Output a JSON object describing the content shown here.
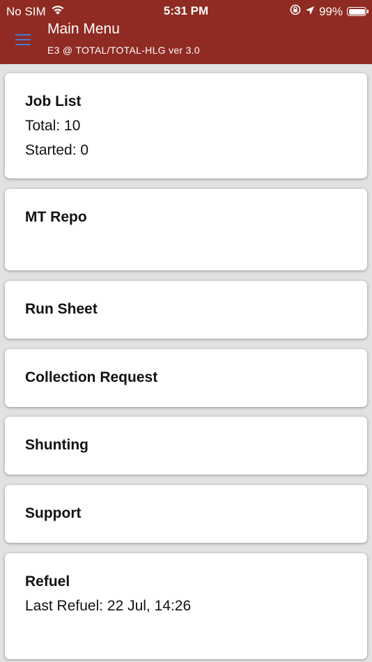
{
  "status_bar": {
    "carrier": "No SIM",
    "time": "5:31 PM",
    "battery": "99%"
  },
  "header": {
    "title": "Main Menu",
    "subtitle": "E3 @ TOTAL/TOTAL-HLG ver 3.0",
    "menu_icon_color": "#4a78d4"
  },
  "colors": {
    "header_bg": "#8f2b22",
    "page_bg": "#e2e2e2",
    "card_bg": "#ffffff"
  },
  "menu": {
    "job_list": {
      "title": "Job List",
      "total": "Total: 10",
      "started": "Started: 0"
    },
    "mt_repo": {
      "title": "MT Repo"
    },
    "run_sheet": {
      "title": "Run Sheet"
    },
    "collection_request": {
      "title": "Collection Request"
    },
    "shunting": {
      "title": "Shunting"
    },
    "support": {
      "title": "Support"
    },
    "refuel": {
      "title": "Refuel",
      "last_refuel": "Last Refuel: 22 Jul, 14:26"
    }
  }
}
